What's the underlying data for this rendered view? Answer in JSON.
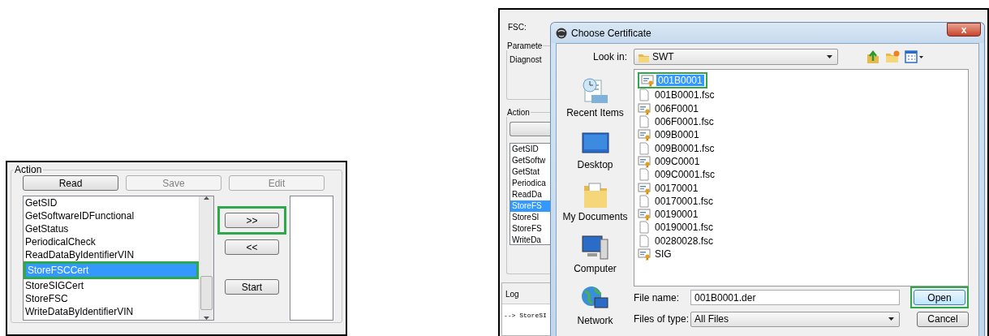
{
  "action_panel": {
    "title": "Action",
    "buttons": [
      {
        "label": "Read",
        "disabled": false
      },
      {
        "label": "Save",
        "disabled": true
      },
      {
        "label": "Edit",
        "disabled": true
      }
    ],
    "commands": [
      {
        "label": "GetSID",
        "selected": false,
        "highlighted": false
      },
      {
        "label": "GetSoftwareIDFunctional",
        "selected": false,
        "highlighted": false
      },
      {
        "label": "GetStatus",
        "selected": false,
        "highlighted": false
      },
      {
        "label": "PeriodicalCheck",
        "selected": false,
        "highlighted": false
      },
      {
        "label": "ReadDataByIdentifierVIN",
        "selected": false,
        "highlighted": false
      },
      {
        "label": "StoreFSCCert",
        "selected": true,
        "highlighted": true
      },
      {
        "label": "StoreSIGCert",
        "selected": false,
        "highlighted": false
      },
      {
        "label": "StoreFSC",
        "selected": false,
        "highlighted": false
      },
      {
        "label": "WriteDataByIdentifierVIN",
        "selected": false,
        "highlighted": false
      }
    ],
    "move_buttons": [
      {
        "label": ">>",
        "highlighted": true
      },
      {
        "label": "<<",
        "highlighted": false
      }
    ],
    "start_button": "Start"
  },
  "background_window": {
    "fsc_label": "FSC:",
    "parameters_title": "Paramete",
    "parameters_text": "Diagnost",
    "action_title": "Action",
    "commands": [
      {
        "label": "GetSID",
        "selected": false
      },
      {
        "label": "GetSoftw",
        "selected": false
      },
      {
        "label": "GetStat",
        "selected": false
      },
      {
        "label": "Periodica",
        "selected": false
      },
      {
        "label": "ReadDa",
        "selected": false
      },
      {
        "label": "StoreFS",
        "selected": true
      },
      {
        "label": "StoreSI",
        "selected": false
      },
      {
        "label": "StoreFS",
        "selected": false
      },
      {
        "label": "WriteDa",
        "selected": false
      }
    ],
    "log_title": "Log",
    "log_line": "--> StoreSI"
  },
  "dialog": {
    "title": "Choose Certificate",
    "close": "x",
    "look_in_label": "Look in:",
    "look_in_value": "SWT",
    "places": [
      {
        "label": "Recent Items",
        "kind": "recent"
      },
      {
        "label": "Desktop",
        "kind": "desktop"
      },
      {
        "label": "My Documents",
        "kind": "documents"
      },
      {
        "label": "Computer",
        "kind": "computer"
      },
      {
        "label": "Network",
        "kind": "network"
      }
    ],
    "files": [
      {
        "name": "001B0001",
        "kind": "certificate",
        "selected": true,
        "highlighted": true
      },
      {
        "name": "001B0001.fsc",
        "kind": "file",
        "selected": false,
        "highlighted": false
      },
      {
        "name": "006F0001",
        "kind": "certificate",
        "selected": false,
        "highlighted": false
      },
      {
        "name": "006F0001.fsc",
        "kind": "file",
        "selected": false,
        "highlighted": false
      },
      {
        "name": "009B0001",
        "kind": "certificate",
        "selected": false,
        "highlighted": false
      },
      {
        "name": "009B0001.fsc",
        "kind": "file",
        "selected": false,
        "highlighted": false
      },
      {
        "name": "009C0001",
        "kind": "certificate",
        "selected": false,
        "highlighted": false
      },
      {
        "name": "009C0001.fsc",
        "kind": "file",
        "selected": false,
        "highlighted": false
      },
      {
        "name": "00170001",
        "kind": "certificate",
        "selected": false,
        "highlighted": false
      },
      {
        "name": "00170001.fsc",
        "kind": "file",
        "selected": false,
        "highlighted": false
      },
      {
        "name": "00190001",
        "kind": "certificate",
        "selected": false,
        "highlighted": false
      },
      {
        "name": "00190001.fsc",
        "kind": "file",
        "selected": false,
        "highlighted": false
      },
      {
        "name": "00280028.fsc",
        "kind": "file",
        "selected": false,
        "highlighted": false
      },
      {
        "name": "SIG",
        "kind": "certificate",
        "selected": false,
        "highlighted": false
      }
    ],
    "file_name_label": "File name:",
    "file_name_value": "001B0001.der",
    "file_type_label": "Files of type:",
    "file_type_value": "All Files",
    "buttons": [
      {
        "label": "Open",
        "default": true,
        "highlighted": true
      },
      {
        "label": "Cancel",
        "default": false,
        "highlighted": false
      }
    ]
  }
}
